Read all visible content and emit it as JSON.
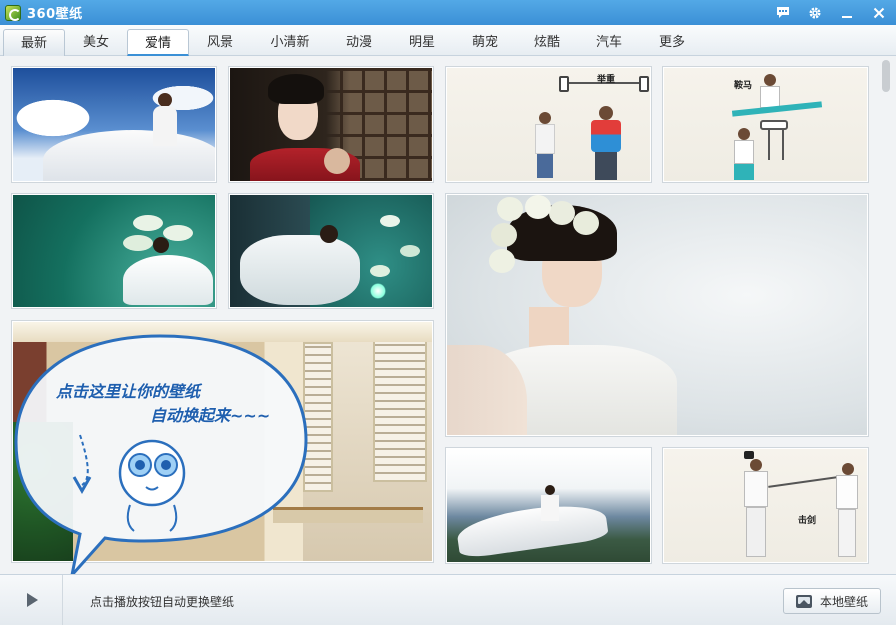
{
  "app": {
    "title": "360壁纸"
  },
  "window_controls": {
    "chat_icon": "chat-bubble-icon",
    "settings_icon": "gear-icon",
    "minimize_icon": "minimize-icon",
    "close_icon": "close-icon"
  },
  "tabs": [
    {
      "label": "最新",
      "state": "hover"
    },
    {
      "label": "美女",
      "state": ""
    },
    {
      "label": "爱情",
      "state": "selected"
    },
    {
      "label": "风景",
      "state": ""
    },
    {
      "label": "小清新",
      "state": ""
    },
    {
      "label": "动漫",
      "state": ""
    },
    {
      "label": "明星",
      "state": ""
    },
    {
      "label": "萌宠",
      "state": ""
    },
    {
      "label": "炫酷",
      "state": ""
    },
    {
      "label": "汽车",
      "state": ""
    },
    {
      "label": "更多",
      "state": ""
    }
  ],
  "wallpapers": {
    "cartoon_labels": {
      "weightlift": "举重",
      "horse": "鞍马",
      "fencing": "击剑"
    }
  },
  "bubble": {
    "line1": "点击这里让你的壁纸",
    "line2": "自动换起来~~~"
  },
  "bottom": {
    "play_icon": "play-icon",
    "hint": "点击播放按钮自动更换壁纸",
    "local_button": "本地壁纸",
    "local_icon": "picture-folder-icon"
  },
  "colors": {
    "titlebar": "#3b90d6",
    "bubble_text": "#1f5fae"
  }
}
